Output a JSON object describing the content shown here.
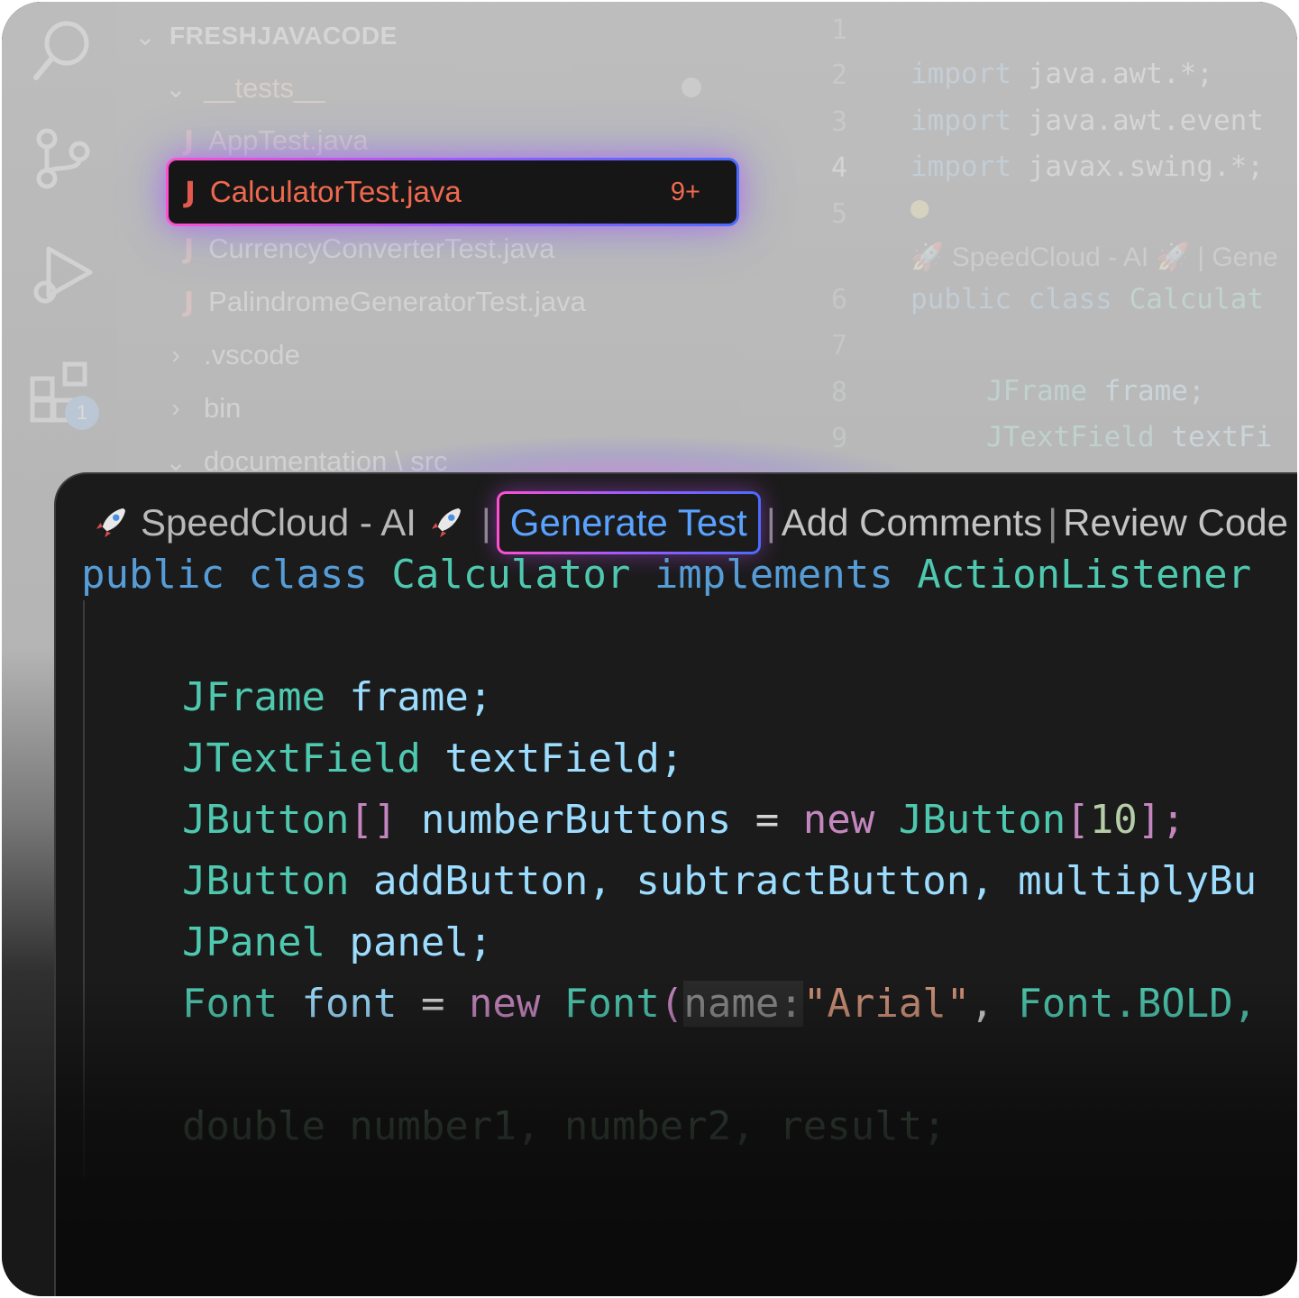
{
  "explorer": {
    "root_label": "FRESHJAVACODE",
    "items": [
      {
        "label": "__tests__",
        "kind": "folder-open"
      },
      {
        "label": "AppTest.java",
        "kind": "java"
      },
      {
        "label": "CalculatorTest.java",
        "kind": "java",
        "selected": true,
        "problems": "9+"
      },
      {
        "label": "CurrencyConverterTest.java",
        "kind": "java"
      },
      {
        "label": "PalindromeGeneratorTest.java",
        "kind": "java"
      },
      {
        "label": ".vscode",
        "kind": "folder-closed"
      },
      {
        "label": "bin",
        "kind": "folder-closed"
      },
      {
        "label": "documentation \\ src",
        "kind": "folder-open"
      }
    ]
  },
  "activity_bar": {
    "icons": [
      "search-icon",
      "source-control-icon",
      "run-debug-icon",
      "extensions-icon"
    ],
    "extensions_badge": "1"
  },
  "editor": {
    "line_numbers": [
      "1",
      "2",
      "3",
      "4",
      "5",
      "6",
      "7",
      "8",
      "9"
    ],
    "active_line": "4",
    "lines": {
      "l2": {
        "kw": "import",
        "rest": "java.awt.*;"
      },
      "l3": {
        "kw": "import",
        "rest": "java.awt.event"
      },
      "l4": {
        "kw": "import",
        "rest": "javax.swing.*;"
      },
      "lens": "🚀 SpeedCloud - AI 🚀 | Gene",
      "l6": {
        "kw": "public class",
        "rest": "Calculat"
      },
      "l8": {
        "type": "JFrame",
        "rest": "frame;"
      },
      "l9": {
        "type": "JTextField",
        "rest": "textFi"
      }
    }
  },
  "codelens": {
    "brand": "SpeedCloud - AI",
    "separator": "|",
    "generate_test": "Generate Test",
    "add_comments": "Add Comments",
    "review_code": "Review Code"
  },
  "code": {
    "public": "public",
    "class": "class",
    "class_name": "Calculator",
    "implements": "implements",
    "iface": "ActionListener",
    "jframe": "JFrame",
    "frame_var": "frame;",
    "jtextfield": "JTextField",
    "textfield_var": "textField;",
    "jbutton": "JButton",
    "brackets": "[]",
    "number_buttons": "numberButtons",
    "eq": "=",
    "new_kw": "new",
    "jbutton2": "JButton",
    "open_br": "[",
    "ten": "10",
    "close_br": "];",
    "jbutton3": "JButton",
    "buttons_list": "addButton, subtractButton, multiplyBu",
    "jpanel": "JPanel",
    "panel_var": "panel;",
    "font_type": "Font",
    "font_var": "font",
    "eq2": "=",
    "new_kw2": "new",
    "font_ctor": "Font",
    "paren": "(",
    "name_hint": "name:",
    "arial": "\"Arial\"",
    "comma": ",",
    "font_bold": "Font.BOLD,",
    "double_line": "double number1, number2, result;"
  },
  "colors": {
    "keyword": "#569cd6",
    "type": "#4ec9b0",
    "variable": "#9cdcfe",
    "control": "#c586c0",
    "number": "#b5cea8",
    "string": "#ce9178",
    "file_error": "#f0694f",
    "accent_gradient": [
      "#ff4fd0",
      "#9b5cff",
      "#4b6bff"
    ]
  }
}
